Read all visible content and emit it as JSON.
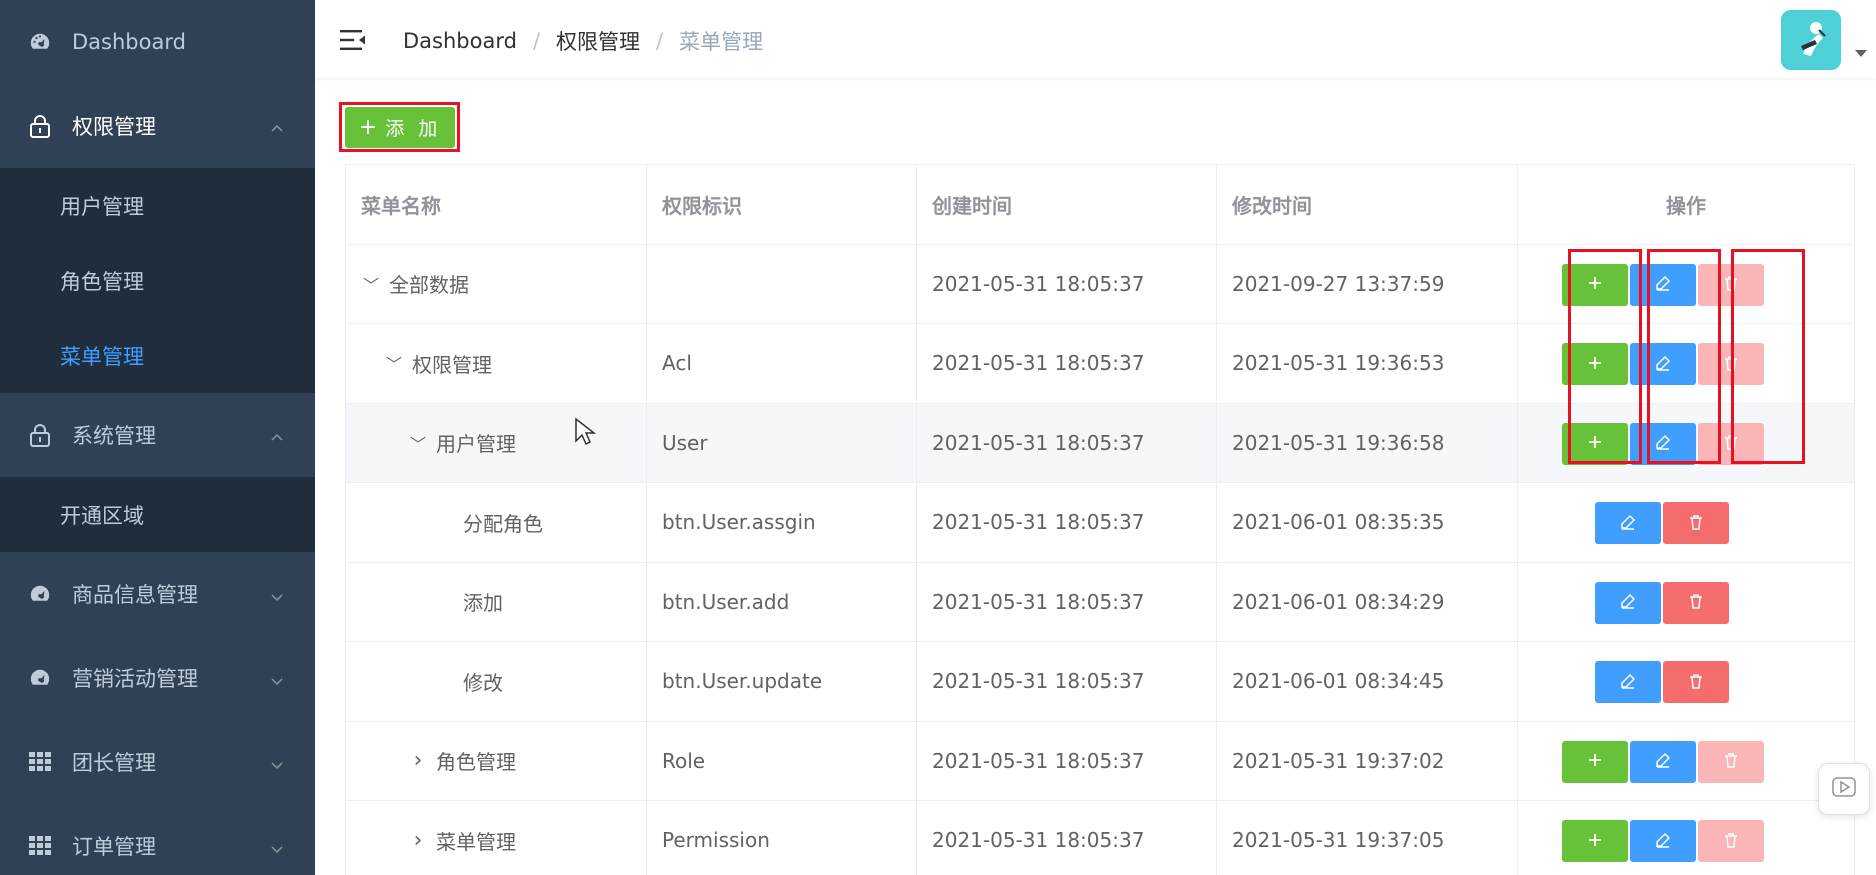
{
  "sidebar": {
    "dashboard": "Dashboard",
    "acl": "权限管理",
    "acl_children": [
      "用户管理",
      "角色管理",
      "菜单管理"
    ],
    "system": "系统管理",
    "system_children": [
      "开通区域"
    ],
    "product": "商品信息管理",
    "marketing": "营销活动管理",
    "leader": "团长管理",
    "order": "订单管理"
  },
  "header": {
    "breadcrumb": [
      "Dashboard",
      "权限管理",
      "菜单管理"
    ],
    "separator": "/"
  },
  "toolbar": {
    "add_label": "添 加",
    "add_icon": "+"
  },
  "table": {
    "columns": [
      "菜单名称",
      "权限标识",
      "创建时间",
      "修改时间",
      "操作"
    ],
    "rows": [
      {
        "name": "全部数据",
        "code": "",
        "created": "2021-05-31 18:05:37",
        "updated": "2021-09-27 13:37:59",
        "expander": "﹀"
      },
      {
        "name": "权限管理",
        "code": "Acl",
        "created": "2021-05-31 18:05:37",
        "updated": "2021-05-31 19:36:53",
        "expander": "﹀"
      },
      {
        "name": "用户管理",
        "code": "User",
        "created": "2021-05-31 18:05:37",
        "updated": "2021-05-31 19:36:58",
        "expander": "﹀"
      },
      {
        "name": "分配角色",
        "code": "btn.User.assgin",
        "created": "2021-05-31 18:05:37",
        "updated": "2021-06-01 08:35:35",
        "expander": ""
      },
      {
        "name": "添加",
        "code": "btn.User.add",
        "created": "2021-05-31 18:05:37",
        "updated": "2021-06-01 08:34:29",
        "expander": ""
      },
      {
        "name": "修改",
        "code": "btn.User.update",
        "created": "2021-05-31 18:05:37",
        "updated": "2021-06-01 08:34:45",
        "expander": ""
      },
      {
        "name": "角色管理",
        "code": "Role",
        "created": "2021-05-31 18:05:37",
        "updated": "2021-05-31 19:37:02",
        "expander": "›"
      },
      {
        "name": "菜单管理",
        "code": "Permission",
        "created": "2021-05-31 18:05:37",
        "updated": "2021-05-31 19:37:05",
        "expander": "›"
      }
    ]
  },
  "colors": {
    "sidebar_bg": "#304156",
    "submenu_bg": "#1f2d3d",
    "active": "#409eff",
    "success": "#67c23a",
    "danger": "#f56c6c",
    "danger_disabled": "#fab6b6",
    "highlight": "#e81123"
  },
  "icons": {
    "dashboard": "gauge-icon",
    "acl": "lock-icon",
    "system": "lock-icon",
    "product": "gauge-icon",
    "marketing": "gauge-icon",
    "leader": "grid-icon",
    "order": "grid-icon",
    "row_add": "plus-icon",
    "row_edit": "edit-icon",
    "row_delete": "trash-icon"
  }
}
